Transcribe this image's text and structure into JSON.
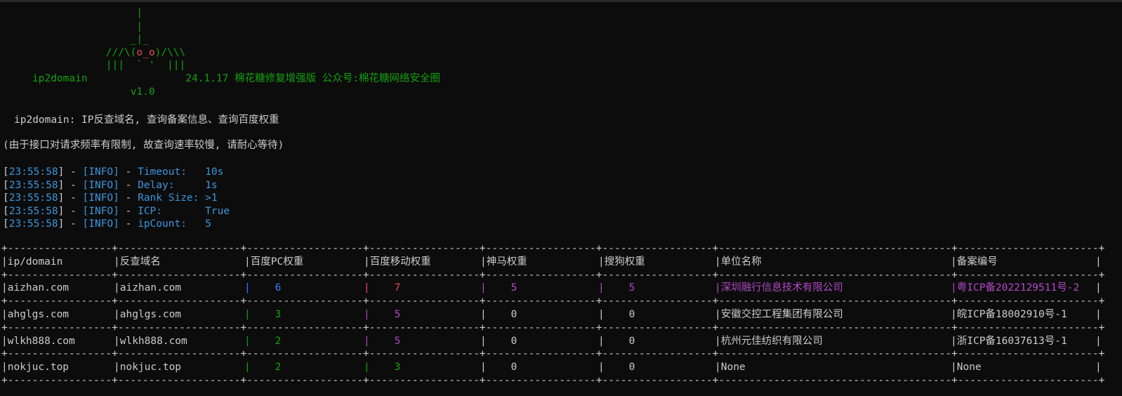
{
  "banner": {
    "art": [
      "                 |",
      "                 |",
      "                _|_",
      "            ///\\(",
      "o_o",
      ")/\\\\\\",
      "            |||  ` '  |||",
      "ip2domain",
      "24.1.17 棉花糖修复增强版 公众号:棉花糖网络安全圈",
      "v1.0"
    ]
  },
  "description": "ip2domain: IP反查域名, 查询备案信息、查询百度权重",
  "note": "(由于接口对请求频率有限制, 故查询速率较慢, 请耐心等待)",
  "log": [
    {
      "time": "23:55:58",
      "level": "INFO",
      "key": "Timeout:",
      "value": "10s"
    },
    {
      "time": "23:55:58",
      "level": "INFO",
      "key": "Delay:",
      "value": "1s"
    },
    {
      "time": "23:55:58",
      "level": "INFO",
      "key": "Rank Size:",
      "value": ">1"
    },
    {
      "time": "23:55:58",
      "level": "INFO",
      "key": "ICP:",
      "value": "True"
    },
    {
      "time": "23:55:58",
      "level": "INFO",
      "key": "ipCount:",
      "value": "5"
    }
  ],
  "table": {
    "headers": [
      "ip/domain",
      "反查域名",
      "百度PC权重",
      "百度移动权重",
      "神马权重",
      "搜狗权重",
      "单位名称",
      "备案编号"
    ],
    "rows": [
      [
        "aizhan.com",
        "aizhan.com",
        "6",
        "7",
        "5",
        "5",
        "深圳融行信息技术有限公司",
        "粤ICP备2022129511号-2"
      ],
      [
        "ahglgs.com",
        "ahglgs.com",
        "3",
        "5",
        "0",
        "0",
        "安徽交控工程集团有限公司",
        "皖ICP备18002910号-1"
      ],
      [
        "wlkh888.com",
        "wlkh888.com",
        "2",
        "5",
        "0",
        "0",
        "杭州元佳纺织有限公司",
        "浙ICP备16037613号-1"
      ],
      [
        "nokjuc.top",
        "nokjuc.top",
        "2",
        "3",
        "0",
        "0",
        "None",
        "None"
      ]
    ]
  },
  "colors": {
    "background": "#0c0c0c",
    "text": "#cccccc",
    "green": "#13a10e",
    "red": "#e74856",
    "blue": "#3b78ff",
    "purple": "#b148c6"
  }
}
